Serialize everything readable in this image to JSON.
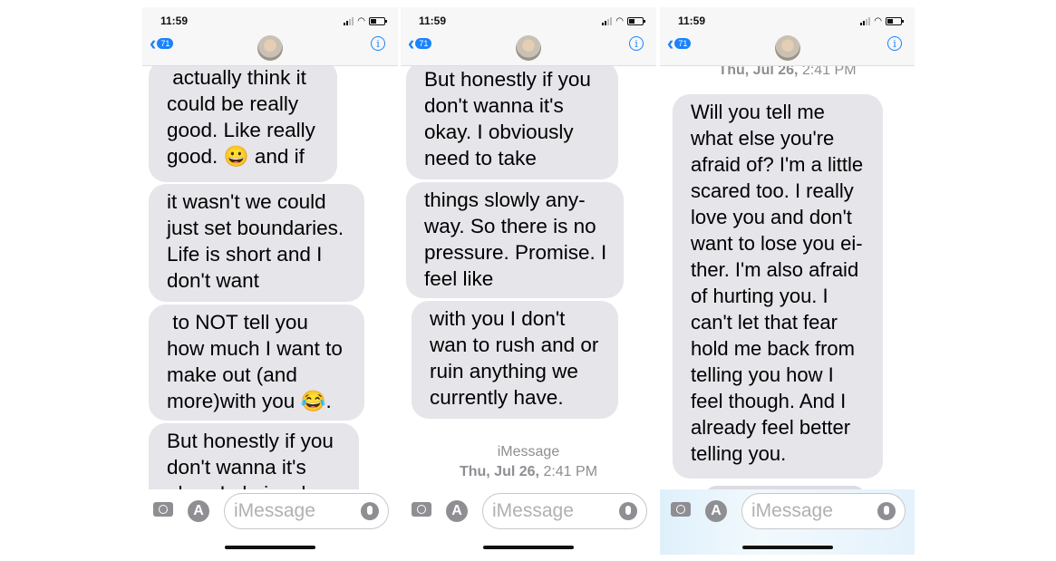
{
  "screens": [
    {
      "status_time": "11:59",
      "back_badge": "71",
      "bubbles": [
        " actually think it\ncould be really\ngood. Like really\ngood. 😀 and if",
        "it wasn't we could\njust set boundaries.\nLife is short and I\ndon't want",
        " to NOT tell you\nhow much I want to\nmake out (and\nmore)with you 😂.",
        "But honestly if you\ndon't wanna it's\nokay. I obviously"
      ],
      "input_placeholder": "iMessage"
    },
    {
      "status_time": "11:59",
      "back_badge": "71",
      "bubbles": [
        "But honestly if you\ndon't wanna it's\nokay. I obviously\nneed to take",
        "things slowly any-\nway. So there is no\npressure. Promise. I\nfeel like",
        "with you I don't\nwan to rush and or\nruin anything we\ncurrently have."
      ],
      "service_label": "iMessage",
      "date_day": "Thu, Jul 26,",
      "date_time": "2:41 PM",
      "input_placeholder": "iMessage"
    },
    {
      "status_time": "11:59",
      "back_badge": "71",
      "date_day": "Thu, Jul 26,",
      "date_time": "2:41 PM",
      "bubbles": [
        "Will you tell me\nwhat else you're\nafraid of? I'm a little\nscared too. I really\nlove you and don't\nwant to lose you ei-\nther. I'm also afraid\nof hurting you. I\ncan't let that fear\nhold me back from\ntelling you how I\nfeel though. And I\nalready feel better\ntelling you."
      ],
      "input_placeholder": "iMessage"
    }
  ]
}
